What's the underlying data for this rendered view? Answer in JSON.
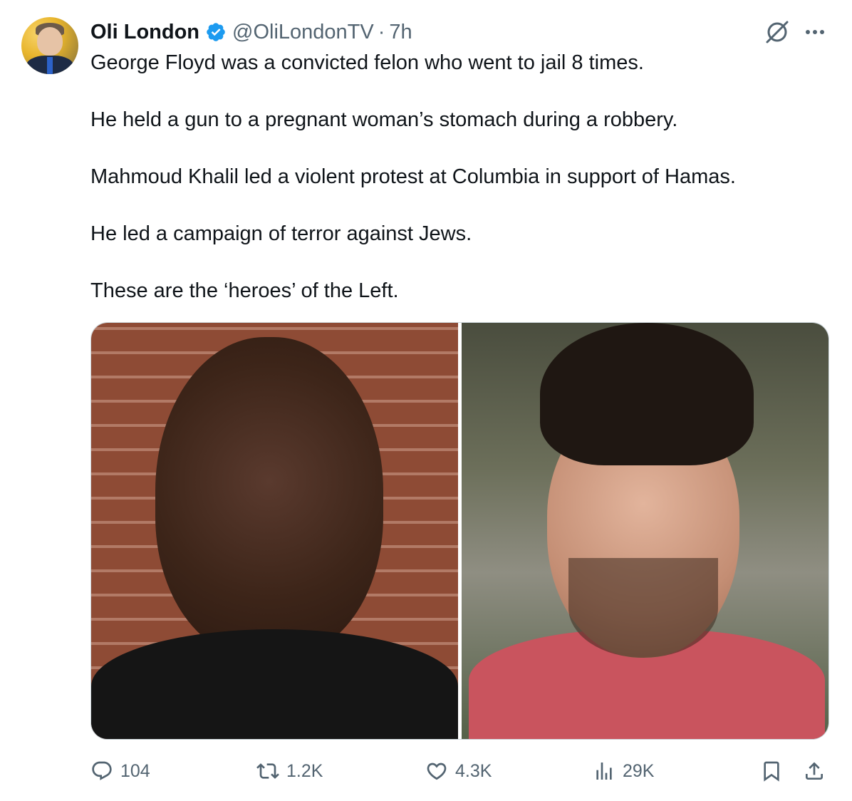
{
  "author": {
    "name": "Oli London",
    "handle": "@OliLondonTV",
    "separator": "·",
    "time": "7h"
  },
  "icons": {
    "verified": "verified-badge-icon",
    "grok": "grok-icon",
    "more": "more-icon",
    "reply": "reply-icon",
    "repost": "repost-icon",
    "like": "like-icon",
    "views": "views-icon",
    "bookmark": "bookmark-icon",
    "share": "share-icon"
  },
  "colors": {
    "accent": "#1d9bf0",
    "text": "#0f1419",
    "muted": "#536471"
  },
  "body": {
    "paragraphs": [
      "George Floyd was a convicted felon who went to jail 8 times.",
      "He held a gun to a pregnant woman’s stomach during a robbery.",
      "Mahmoud Khalil led a violent protest at Columbia in support of Hamas.",
      "He led a campaign of terror against Jews.",
      "These are the ‘heroes’ of the Left."
    ]
  },
  "metrics": {
    "replies": "104",
    "reposts": "1.2K",
    "likes": "4.3K",
    "views": "29K"
  }
}
